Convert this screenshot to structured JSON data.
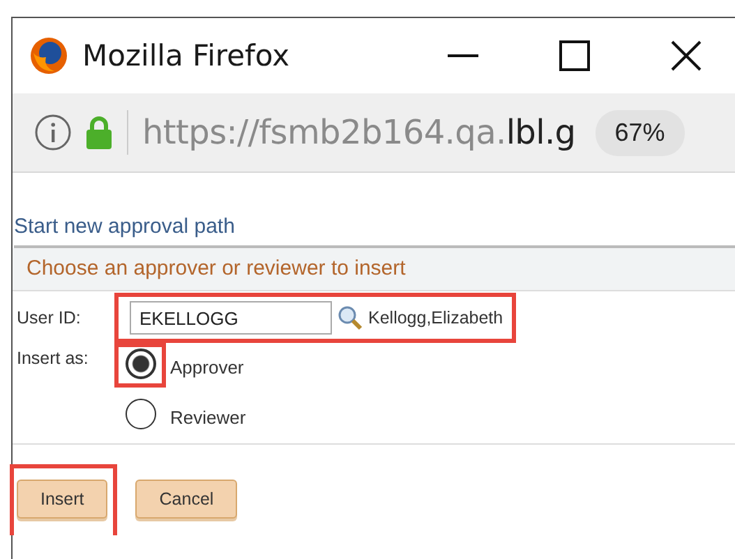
{
  "window": {
    "title": "Mozilla Firefox"
  },
  "address_bar": {
    "url_host": "https://fsmb2b164.qa.",
    "url_domain": "lbl.g",
    "zoom": "67%"
  },
  "page": {
    "heading": "Start new approval path",
    "section_title": "Choose an approver or reviewer to insert",
    "user_id": {
      "label": "User ID:",
      "value": "EKELLOGG",
      "name": "Kellogg,Elizabeth"
    },
    "insert_as": {
      "label": "Insert as:",
      "options": [
        {
          "label": "Approver",
          "selected": true
        },
        {
          "label": "Reviewer",
          "selected": false
        }
      ]
    },
    "buttons": [
      {
        "label": "Insert"
      },
      {
        "label": "Cancel"
      }
    ]
  }
}
